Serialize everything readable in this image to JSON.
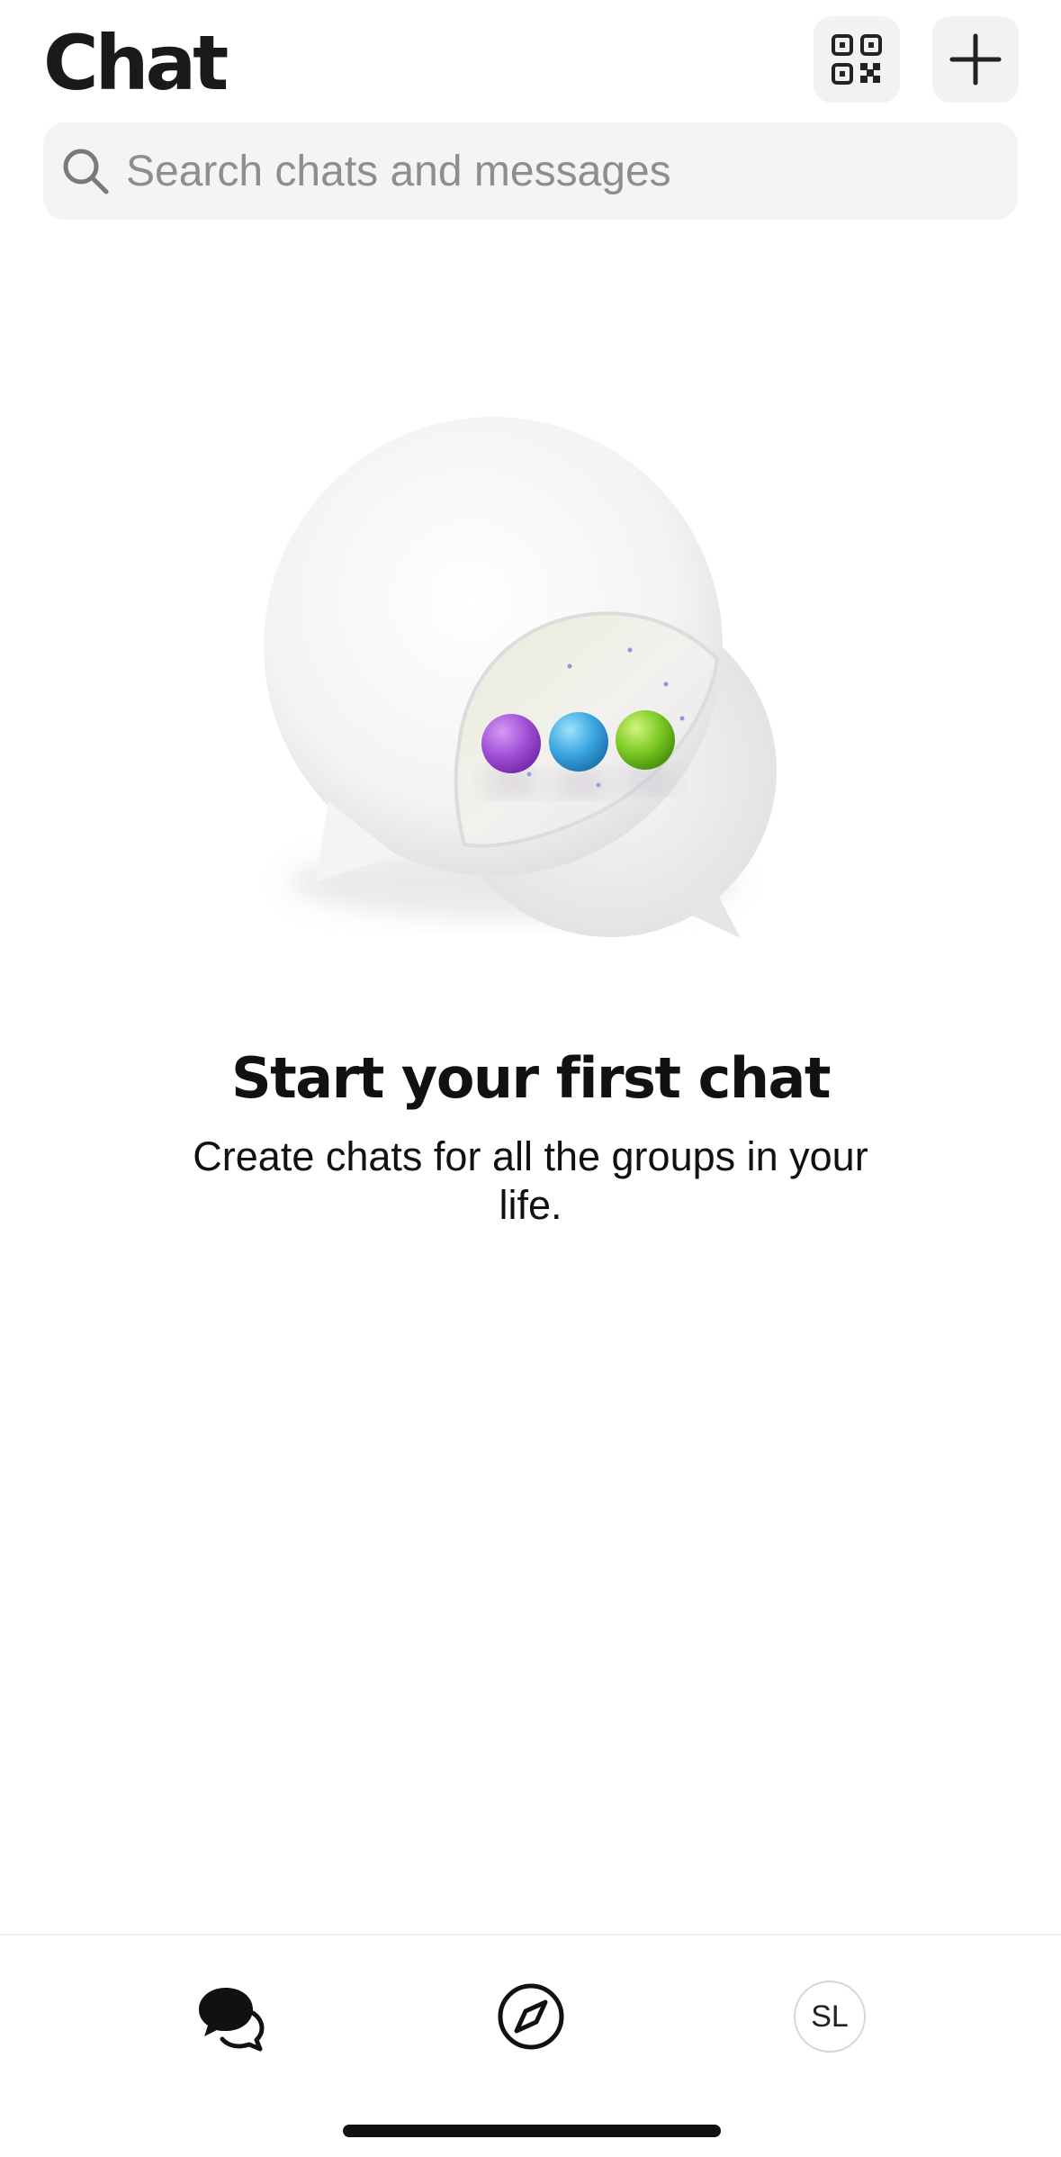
{
  "header": {
    "title": "Chat",
    "qr_icon": "qr-code-icon",
    "new_chat_icon": "plus-icon"
  },
  "search": {
    "placeholder": "Search chats and messages",
    "icon": "search-icon"
  },
  "empty_state": {
    "illustration": "chat-bubbles-illustration",
    "title": "Start your first chat",
    "subtitle": "Create chats for all the groups in your life."
  },
  "bottom_nav": {
    "items": [
      {
        "id": "chats",
        "icon": "chat-bubbles-icon",
        "active": true
      },
      {
        "id": "explore",
        "icon": "compass-icon",
        "active": false
      },
      {
        "id": "profile",
        "avatar_initials": "SL"
      }
    ]
  },
  "colors": {
    "background": "#ffffff",
    "button_bg": "#f2f2f2",
    "search_bg": "#f4f4f4",
    "placeholder": "#8e8e8e",
    "dot_purple": "#a24fd6",
    "dot_blue": "#3aa6e0",
    "dot_green": "#7cc924"
  }
}
